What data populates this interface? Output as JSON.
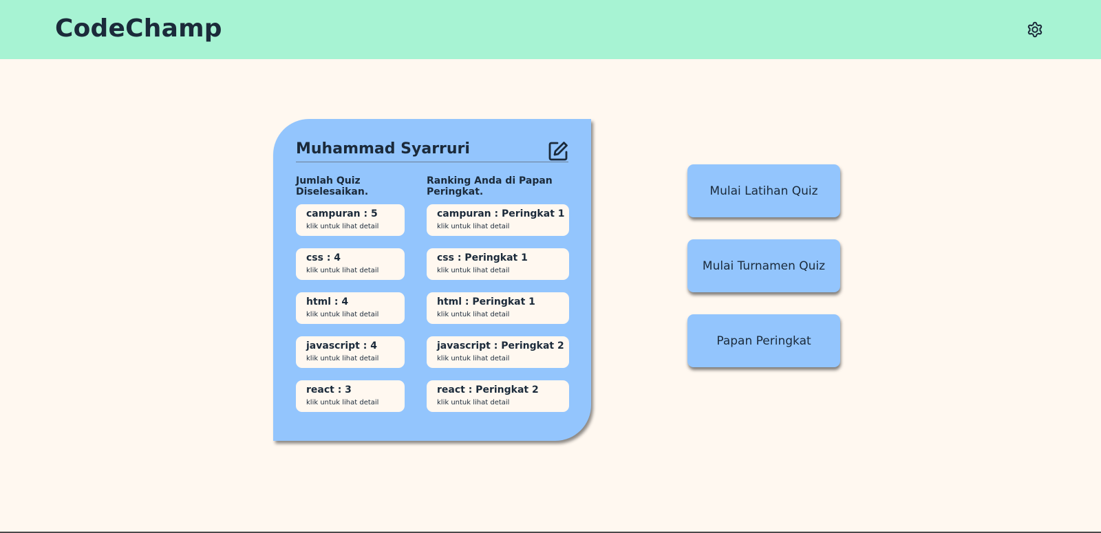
{
  "header": {
    "brand": "CodeChamp",
    "settings_icon": "gear-icon"
  },
  "profile": {
    "name": "Muhammad Syarruri",
    "edit_icon": "edit-icon",
    "quiz_count_title": "Jumlah Quiz Diselesaikan.",
    "ranking_title": "Ranking Anda di Papan Peringkat.",
    "detail_hint": "klik untuk lihat detail",
    "quiz_counts": [
      {
        "label": "campuran : 5",
        "hint": "klik untuk lihat detail"
      },
      {
        "label": "css : 4",
        "hint": "klik untuk lihat detail"
      },
      {
        "label": "html : 4",
        "hint": "klik untuk lihat detail"
      },
      {
        "label": "javascript : 4",
        "hint": "klik untuk lihat detail"
      },
      {
        "label": "react : 3",
        "hint": "klik untuk lihat detail"
      }
    ],
    "rankings": [
      {
        "label": "campuran : Peringkat 1",
        "hint": "klik untuk lihat detail"
      },
      {
        "label": "css : Peringkat 1",
        "hint": "klik untuk lihat detail"
      },
      {
        "label": "html : Peringkat 1",
        "hint": "klik untuk lihat detail"
      },
      {
        "label": "javascript : Peringkat 2",
        "hint": "klik untuk lihat detail"
      },
      {
        "label": "react : Peringkat 2",
        "hint": "klik untuk lihat detail"
      }
    ]
  },
  "actions": {
    "practice": "Mulai Latihan Quiz",
    "tournament": "Mulai Turnamen Quiz",
    "leaderboard": "Papan Peringkat"
  },
  "colors": {
    "header_bg": "#a7f3d3",
    "page_bg": "#fff8f0",
    "card_bg": "#93c5fd",
    "text": "#1b2a3a"
  }
}
